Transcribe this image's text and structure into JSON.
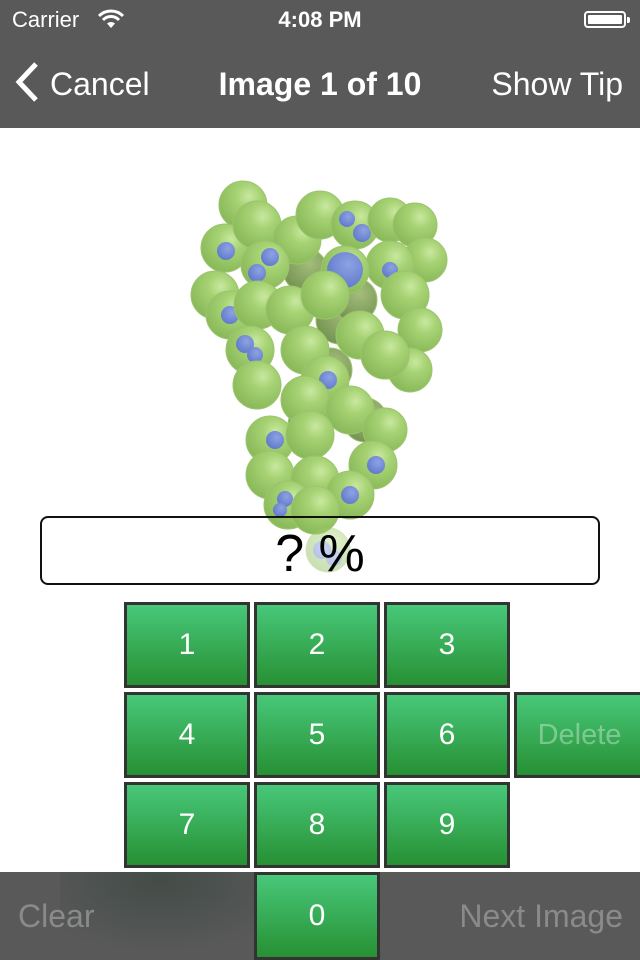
{
  "status_bar": {
    "carrier": "Carrier",
    "time": "4:08 PM"
  },
  "nav": {
    "back_label": "Cancel",
    "title": "Image 1 of 10",
    "right_label": "Show Tip"
  },
  "answer": {
    "value": "?",
    "unit": "%",
    "display": "? %"
  },
  "keypad": {
    "keys": [
      "1",
      "2",
      "3",
      "4",
      "5",
      "6",
      "7",
      "8",
      "9",
      "0"
    ],
    "delete_label": "Delete"
  },
  "toolbar": {
    "clear_label": "Clear",
    "next_label": "Next Image"
  },
  "colors": {
    "bar": "#595959",
    "key_top": "#48c87a",
    "key_bottom": "#279033",
    "cell_green": "#9cc86a",
    "nucleus_blue": "#6f86d4"
  }
}
